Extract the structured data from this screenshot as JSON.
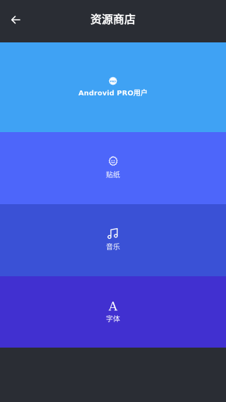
{
  "header": {
    "title": "资源商店",
    "back_icon": "arrow-left-icon"
  },
  "tiles": [
    {
      "id": "pro",
      "label": "Androvid PRO用户",
      "icon": "pro-badge-icon",
      "icon_text": "PRO",
      "color": "#3fa2f4"
    },
    {
      "id": "stickers",
      "label": "贴纸",
      "icon": "sticker-face-icon",
      "color": "#4d66fa"
    },
    {
      "id": "music",
      "label": "音乐",
      "icon": "music-note-icon",
      "color": "#3a51d6"
    },
    {
      "id": "fonts",
      "label": "字体",
      "icon": "font-a-icon",
      "icon_text": "A",
      "color": "#4130d0"
    }
  ],
  "colors": {
    "background": "#2a2d34",
    "text": "#ffffff"
  }
}
